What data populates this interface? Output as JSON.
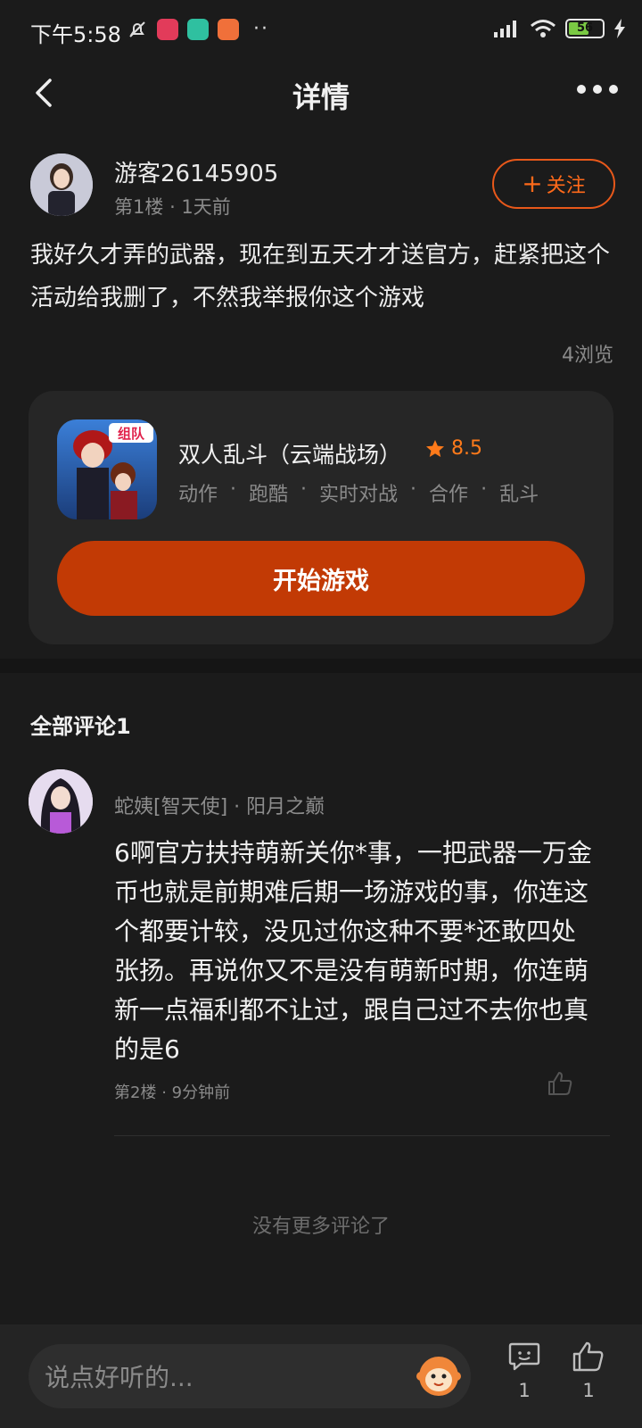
{
  "status_bar": {
    "time": "下午5:58",
    "battery": "56",
    "icons": [
      "bell-off-icon",
      "app-icon-red",
      "app-icon-green",
      "app-icon-orange",
      "more-dots-icon",
      "hd-signal-icon",
      "wifi-icon",
      "battery-icon",
      "charging-icon"
    ],
    "dots": "··"
  },
  "header": {
    "title": "详情"
  },
  "post": {
    "username": "游客26145905",
    "floor": "第1楼",
    "time": "1天前",
    "follow_label": "关注",
    "follow_plus": "+",
    "content": "我好久才弄的武器，现在到五天才才送官方，赶紧把这个活动给我删了，不然我举报你这个游戏",
    "views": "4浏览"
  },
  "game": {
    "name": "双人乱斗（云端战场）",
    "rating": "8.5",
    "tags": [
      "动作",
      "跑酷",
      "实时对战",
      "合作",
      "乱斗"
    ],
    "play_label": "开始游戏",
    "icon_badge": "组队"
  },
  "comments": {
    "title": "全部评论1",
    "items": [
      {
        "user": "蛇姨[智天使] · 阳月之巅",
        "text": "6啊官方扶持萌新关你*事，一把武器一万金币也就是前期难后期一场游戏的事，你连这个都要计较，没见过你这种不要*还敢四处张扬。再说你又不是没有萌新时期，你连萌新一点福利都不让过，跟自己过不去你也真的是6",
        "floor": "第2楼",
        "time": "9分钟前"
      }
    ],
    "no_more": "没有更多评论了"
  },
  "bottom_bar": {
    "input_placeholder": "说点好听的...",
    "comment_count": "1",
    "like_count": "1"
  },
  "colors": {
    "accent": "#e8581a",
    "play_button": "#c23a05",
    "background": "#1b1b1b"
  }
}
